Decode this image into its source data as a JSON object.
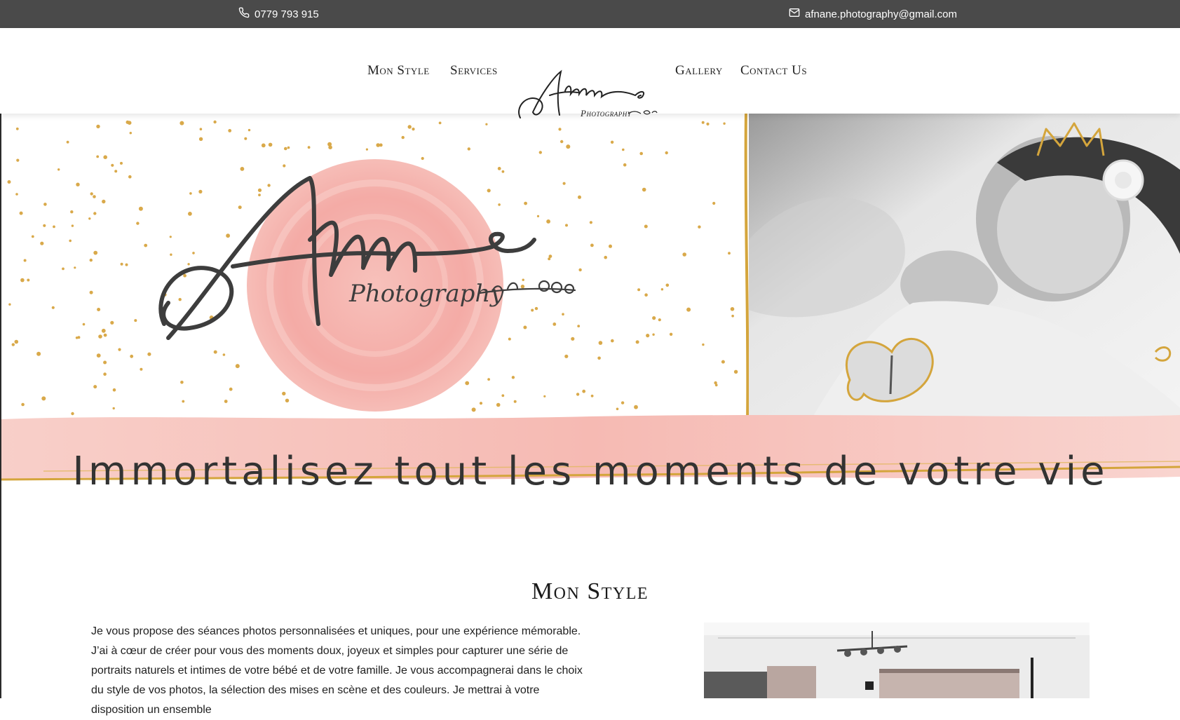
{
  "topbar": {
    "phone": "0779 793 915",
    "email": "afnane.photography@gmail.com",
    "phone_icon": "phone-icon",
    "email_icon": "envelope-icon",
    "background": "#4a4a4a"
  },
  "nav": {
    "items": [
      {
        "label": "Mon Style"
      },
      {
        "label": "Services"
      },
      {
        "label": "Gallery"
      },
      {
        "label": "Contact Us"
      }
    ]
  },
  "logo": {
    "script": "Afnane",
    "subtitle": "Photography"
  },
  "hero": {
    "logo_script": "Afnane",
    "logo_subtitle": "Photography",
    "tagline": "Immortalisez tout les moments de votre vie",
    "accent_gold": "#d4a53c",
    "accent_pink": "#f5b5b0"
  },
  "mon_style": {
    "title": "Mon Style",
    "text": "Je vous propose des séances photos personnalisées et uniques, pour une expérience mémorable. J’ai à cœur de créer pour vous des moments doux, joyeux et simples pour capturer une série de portraits naturels et intimes de votre bébé et de votre famille. Je vous accompagnerai dans le choix du style de vos photos, la sélection des mises en scène et des couleurs. Je mettrai à votre disposition un ensemble"
  }
}
